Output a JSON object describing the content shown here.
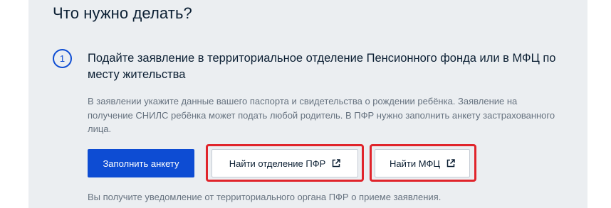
{
  "section": {
    "title": "Что нужно делать?"
  },
  "step": {
    "number": "1",
    "heading": "Подайте заявление в территориальное отделение Пенсионного фонда или в МФЦ по месту жительства",
    "description": "В заявлении укажите данные вашего паспорта и свидетельства о рождении ребёнка. Заявление на получение СНИЛС ребёнка может подать любой родитель. В ПФР нужно заполнить анкету застрахованного лица.",
    "footnote": "Вы получите уведомление от территориального органа ПФР о приеме заявления."
  },
  "actions": {
    "fill_form_label": "Заполнить анкету",
    "find_pfr_label": "Найти отделение ПФР",
    "find_mfc_label": "Найти МФЦ",
    "external_icon": "external-link-icon"
  },
  "colors": {
    "background_card": "#ebeef1",
    "accent_blue": "#0d4cd3",
    "highlight_red": "#e0242b",
    "text_primary": "#0b1f33",
    "text_secondary": "#66727f"
  }
}
